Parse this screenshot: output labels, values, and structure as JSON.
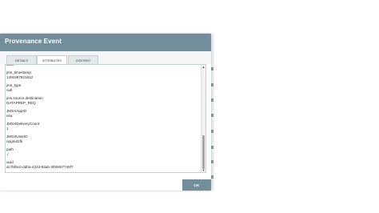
{
  "dialog": {
    "title": "Provenance Event",
    "ok_label": "OK"
  },
  "tabs": [
    {
      "label": "DETAILS",
      "active": false
    },
    {
      "label": "ATTRIBUTES",
      "active": true
    },
    {
      "label": "CONTENT",
      "active": false
    }
  ],
  "attributes": {
    "first_value": "false",
    "items": [
      {
        "name": "jms_timestamp",
        "value": "1491597821612"
      },
      {
        "name": "jms_type",
        "value": "null"
      },
      {
        "name": "jms.source.destination",
        "value": "DATAPREP_REQ"
      },
      {
        "name": "JMSXAppID",
        "value": "esa"
      },
      {
        "name": "JMSXDeliveryCount",
        "value": "1"
      },
      {
        "name": "JMSXUserID",
        "value": "npgmd1fk"
      },
      {
        "name": "path",
        "value": "./"
      },
      {
        "name": "uuid",
        "value": "dc7bf5c0-dd0a-4223-93ab-2f00607746f7"
      }
    ]
  },
  "scrollbar": {
    "up_arrow_icon": "triangle-up-icon",
    "down_arrow_icon": "triangle-down-icon"
  },
  "colors": {
    "header": "#728e9b",
    "button": "#728e9b"
  }
}
